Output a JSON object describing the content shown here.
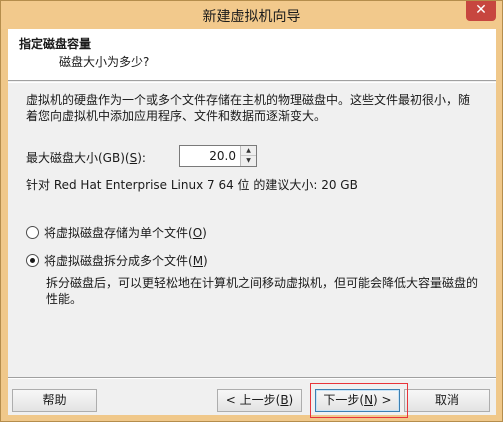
{
  "window": {
    "title": "新建虚拟机向导",
    "close_glyph": "✕"
  },
  "header": {
    "title": "指定磁盘容量",
    "subtitle": "磁盘大小为多少?"
  },
  "description": "虚拟机的硬盘作为一个或多个文件存储在主机的物理磁盘中。这些文件最初很小，随着您向虚拟机中添加应用程序、文件和数据而逐渐变大。",
  "disk_size": {
    "label_pre": "最大磁盘大小(GB)(",
    "label_key": "S",
    "label_post": "):",
    "value": "20.0"
  },
  "recommendation": "针对 Red Hat Enterprise Linux 7 64 位 的建议大小: 20 GB",
  "options": [
    {
      "label_pre": "将虚拟磁盘存储为单个文件(",
      "key": "O",
      "label_post": ")",
      "checked": false
    },
    {
      "label_pre": "将虚拟磁盘拆分成多个文件(",
      "key": "M",
      "label_post": ")",
      "checked": true
    }
  ],
  "split_note": "拆分磁盘后，可以更轻松地在计算机之间移动虚拟机，但可能会降低大容量磁盘的性能。",
  "buttons": {
    "help": "帮助",
    "back_pre": "< 上一步(",
    "back_key": "B",
    "back_post": ")",
    "next_pre": "下一步(",
    "next_key": "N",
    "next_post": ") >",
    "cancel": "取消"
  },
  "colors": {
    "title_bar": "#f2c98c",
    "close": "#c7463f",
    "highlight": "#e8343a"
  }
}
